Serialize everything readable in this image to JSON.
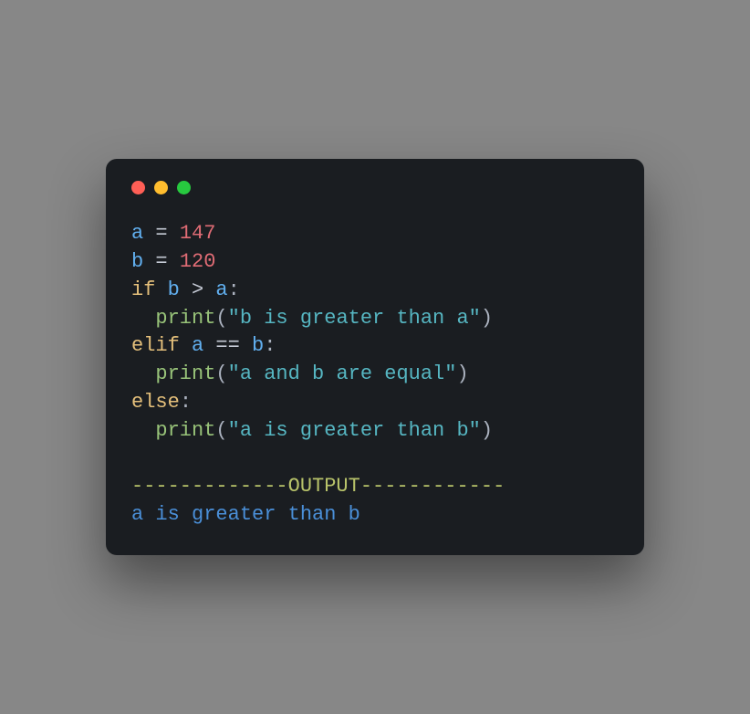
{
  "code": {
    "l1": {
      "a": "a",
      "eq": " = ",
      "v": "147"
    },
    "l2": {
      "b": "b",
      "eq": " = ",
      "v": "120"
    },
    "l3": {
      "kw": "if",
      "sp": " ",
      "b": "b",
      "op": " > ",
      "a": "a",
      "colon": ":"
    },
    "l4": {
      "indent": "  ",
      "fn": "print",
      "lp": "(",
      "str": "\"b is greater than a\"",
      "rp": ")"
    },
    "l5": {
      "kw": "elif",
      "sp": " ",
      "a": "a",
      "op": " == ",
      "b": "b",
      "colon": ":"
    },
    "l6": {
      "indent": "  ",
      "fn": "print",
      "lp": "(",
      "str": "\"a and b are equal\"",
      "rp": ")"
    },
    "l7": {
      "kw": "else",
      "colon": ":"
    },
    "l8": {
      "indent": "  ",
      "fn": "print",
      "lp": "(",
      "str": "\"a is greater than b\"",
      "rp": ")"
    },
    "sep": "-------------OUTPUT------------",
    "output": "a is greater than b"
  }
}
